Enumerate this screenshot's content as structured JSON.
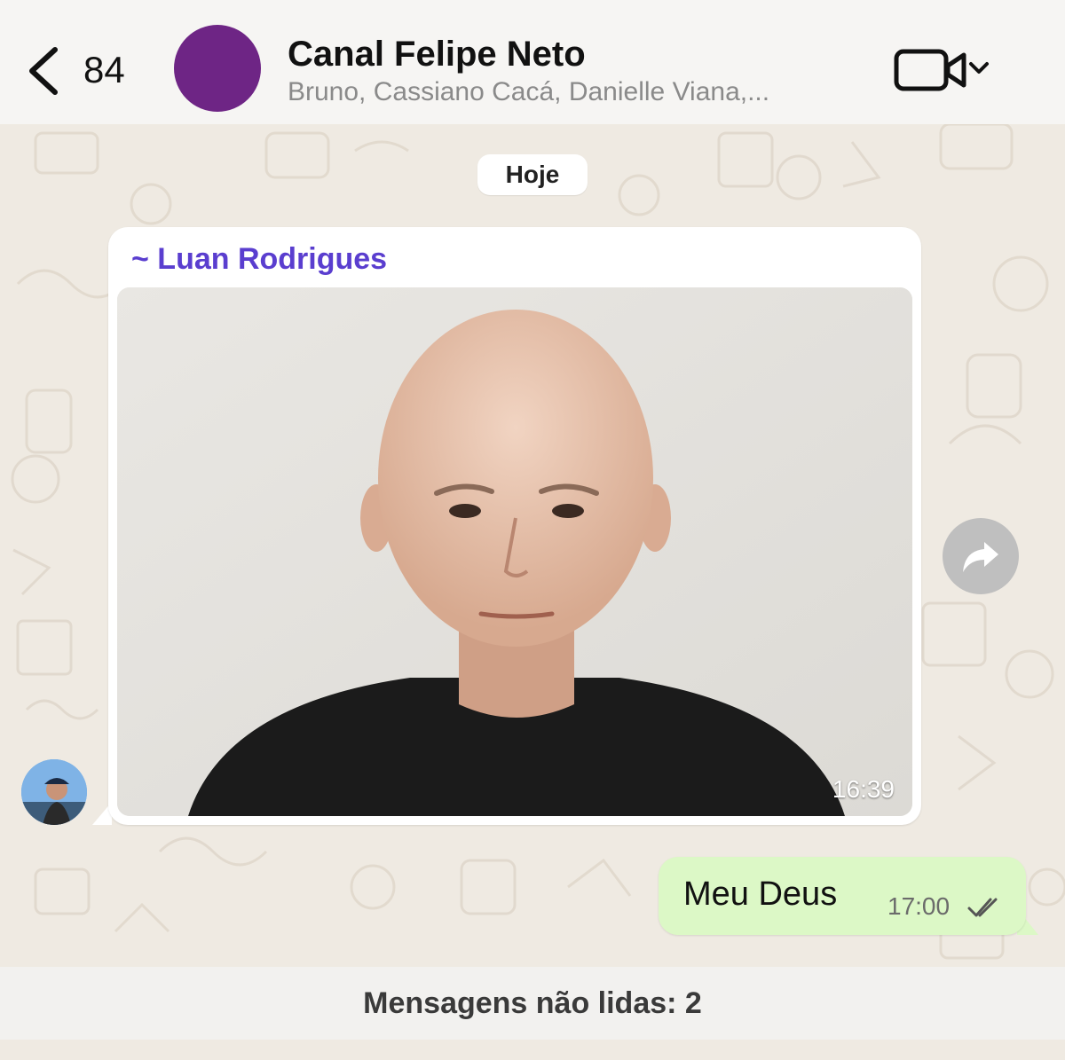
{
  "header": {
    "back_count": "84",
    "title": "Canal Felipe Neto",
    "subtitle": "Bruno, Cassiano Cacá, Danielle Viana,...",
    "avatar_color": "#6e2585"
  },
  "chat": {
    "date_label": "Hoje",
    "messages": [
      {
        "direction": "incoming",
        "sender": "~ Luan Rodrigues",
        "sender_color": "#5a3ecf",
        "type": "image",
        "image_icon": "portrait-photo",
        "time": "16:39"
      },
      {
        "direction": "outgoing",
        "text": "Meu Deus",
        "time": "17:00",
        "status_icon": "double-check-icon"
      }
    ]
  },
  "unread_banner": "Mensagens não lidas: 2",
  "colors": {
    "outgoing_bubble": "#dcf8c6",
    "incoming_bubble": "#ffffff",
    "wallpaper": "#efeae2"
  }
}
